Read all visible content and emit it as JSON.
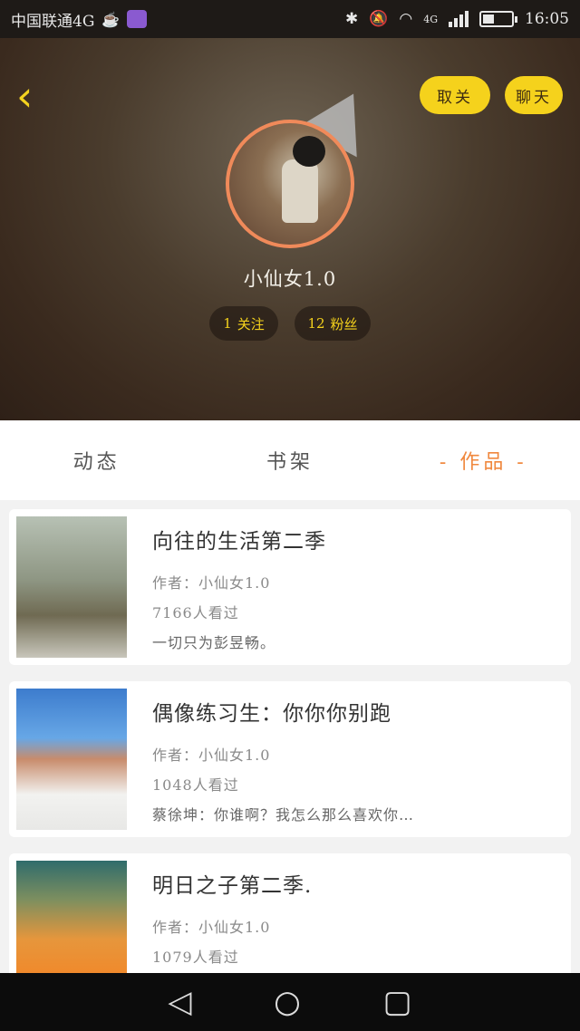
{
  "status_bar": {
    "carrier": "中国联通4G",
    "network": "4G",
    "time": "16:05",
    "battery_level": 0.4
  },
  "header": {
    "back_icon": "chevron-left-icon",
    "unfollow_label": "取关",
    "chat_label": "聊天",
    "username": "小仙女1.0",
    "following_count": "1",
    "following_label": "关注",
    "followers_count": "12",
    "followers_label": "粉丝",
    "accent_color": "#f5d21c"
  },
  "tabs": [
    {
      "label": "动态",
      "active": false
    },
    {
      "label": "书架",
      "active": false
    },
    {
      "label": "- 作品 -",
      "active": true
    }
  ],
  "works": [
    {
      "title": "向往的生活第二季",
      "author": "作者：小仙女1.0",
      "views": "7166人看过",
      "summary": "一切只为彭昱畅。"
    },
    {
      "title": "偶像练习生：你你你别跑",
      "author": "作者：小仙女1.0",
      "views": "1048人看过",
      "summary": "蔡徐坤：你谁啊？我怎么那么喜欢你…"
    },
    {
      "title": "明日之子第二季.",
      "author": "作者：小仙女1.0",
      "views": "1079人看过",
      "summary": ""
    }
  ],
  "nav_bar": {
    "back_icon": "triangle-back-icon",
    "home_icon": "circle-home-icon",
    "recents_icon": "square-recents-icon"
  }
}
